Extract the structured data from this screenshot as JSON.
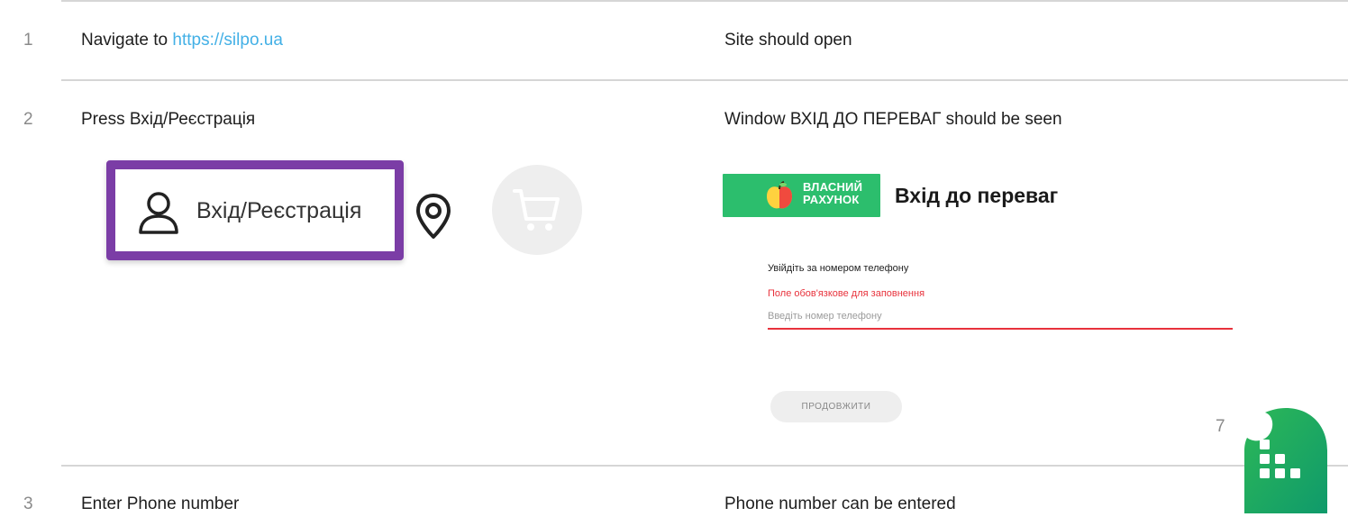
{
  "rows": [
    {
      "number": "1",
      "action_prefix": "Navigate to ",
      "action_link": "https://silpo.ua",
      "expected": "Site should open"
    },
    {
      "number": "2",
      "action": "Press Вхід/Реєстрація",
      "expected": "Window ВХІД ДО ПЕРЕВАГ should be seen"
    },
    {
      "number": "3",
      "action": "Enter Phone number",
      "expected": "Phone number can be entered"
    }
  ],
  "login_illustration": {
    "label": "Вхід/Реєстрація",
    "icons": [
      "user-icon",
      "location-pin-icon",
      "cart-icon"
    ],
    "highlight_color": "#7b3da6"
  },
  "login_panel": {
    "badge_text": "ВЛАСНИЙ РАХУНОК",
    "title": "Вхід до переваг",
    "phone_label": "Увійдіть за номером телефону",
    "error_text": "Поле обов'язкове для заповнення",
    "phone_placeholder": "Введіть номер телефону",
    "continue_label": "ПРОДОВЖИТИ",
    "brand_color": "#2cbe6d",
    "error_color": "#e8323c"
  },
  "page_number": "7",
  "colors": {
    "link": "#43b0e6",
    "logo_green": "#1fae5b"
  }
}
